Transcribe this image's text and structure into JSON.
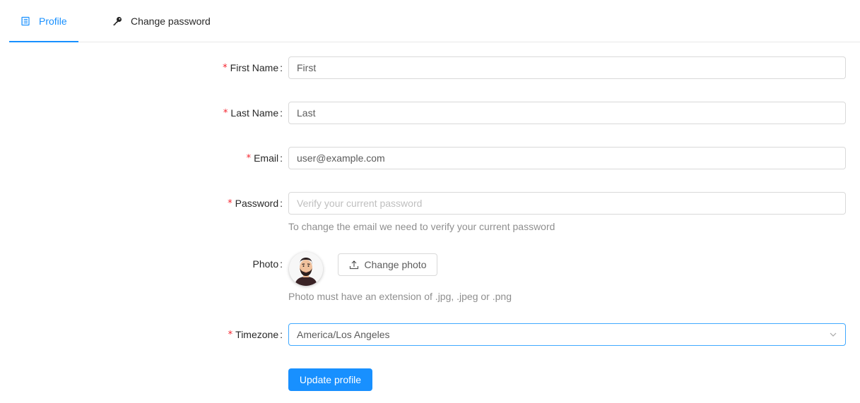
{
  "tabs": [
    {
      "label": "Profile",
      "icon": "profile-icon",
      "active": true
    },
    {
      "label": "Change password",
      "icon": "key-icon",
      "active": false
    }
  ],
  "form": {
    "first_name": {
      "label": "First Name",
      "value": "First",
      "required": true
    },
    "last_name": {
      "label": "Last Name",
      "value": "Last",
      "required": true
    },
    "email": {
      "label": "Email",
      "value": "user@example.com",
      "required": true
    },
    "password": {
      "label": "Password",
      "placeholder": "Verify your current password",
      "help": "To change the email we need to verify your current password",
      "required": true
    },
    "photo": {
      "label": "Photo",
      "button_label": "Change photo",
      "help": "Photo must have an extension of .jpg, .jpeg or .png"
    },
    "timezone": {
      "label": "Timezone",
      "value": "America/Los Angeles",
      "required": true
    },
    "submit_label": "Update profile"
  },
  "colors": {
    "primary": "#1890ff",
    "required_mark": "#f5222d",
    "border": "#d9d9d9"
  }
}
